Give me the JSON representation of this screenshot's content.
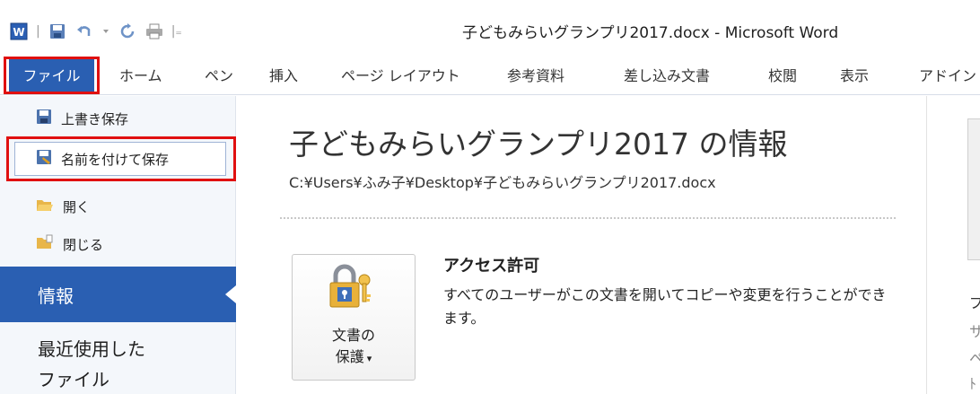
{
  "window": {
    "title": "子どもみらいグランプリ2017.docx - Microsoft Word"
  },
  "quick_access": {
    "icons": [
      "word-app-icon",
      "save-icon",
      "undo-icon",
      "dropdown-icon",
      "redo-icon",
      "print-icon",
      "customize-icon"
    ]
  },
  "ribbon": {
    "file_tab": "ファイル",
    "tabs": [
      "ホーム",
      "ペン",
      "挿入",
      "ページ レイアウト",
      "参考資料",
      "差し込み文書",
      "校閲",
      "表示",
      "アドイン"
    ]
  },
  "backstage": {
    "commands": {
      "save": "上書き保存",
      "save_as": "名前を付けて保存",
      "open": "開く",
      "close": "閉じる"
    },
    "info": "情報",
    "recent_line1": "最近使用した",
    "recent_line2": "ファイル"
  },
  "info_page": {
    "title": "子どもみらいグランプリ2017 の情報",
    "path": "C:¥Users¥ふみ子¥Desktop¥子どもみらいグランプリ2017.docx",
    "protect_button": {
      "line1": "文書の",
      "line2": "保護",
      "arrow": "▾"
    },
    "permissions": {
      "heading": "アクセス許可",
      "description": "すべてのユーザーがこの文書を開いてコピーや変更を行うことができます。"
    },
    "right_fragments": [
      "プ",
      "サ",
      "ペ",
      "ﾄ"
    ]
  },
  "colors": {
    "file_tab": "#2a5fb2",
    "highlight_box": "#e01010",
    "nav_selected": "#2a5fb2"
  }
}
